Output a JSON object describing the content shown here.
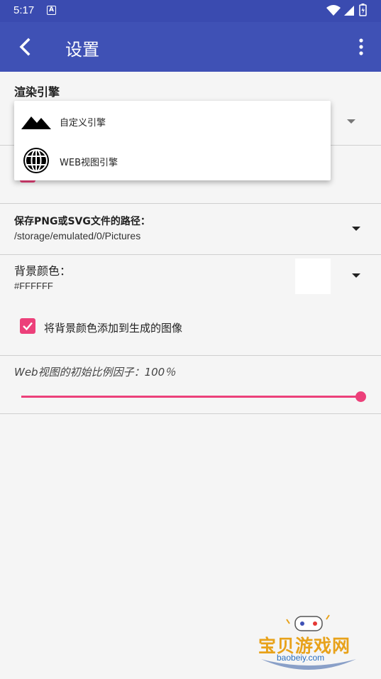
{
  "status_bar": {
    "time": "5:17",
    "notification_glyph": "A"
  },
  "app_bar": {
    "title": "设置",
    "back_icon": "chevron-left-icon",
    "more_icon": "more-vert-icon"
  },
  "render_engine": {
    "label": "渲染引擎",
    "options": [
      {
        "icon": "mountain-icon",
        "label": "自定义引擎"
      },
      {
        "icon": "globe-icon",
        "label": "WEB视图引擎"
      }
    ]
  },
  "save_path": {
    "label": "保存PNG或SVG文件的路径：",
    "value": "/storage/emulated/0/Pictures"
  },
  "background_color": {
    "label": "背景颜色：",
    "value": "#FFFFFF",
    "swatch": "#FFFFFF"
  },
  "add_bg_checkbox": {
    "label": "将背景颜色添加到生成的图像",
    "checked": true
  },
  "scale": {
    "label": "Web视图的初始比例因子：100％",
    "value_percent": 100
  },
  "watermark": {
    "cn": "宝贝游戏网",
    "en": "baobeiy.com"
  },
  "colors": {
    "primary": "#3f51b5",
    "status_bar": "#3a4bb0",
    "accent": "#ec407a"
  }
}
